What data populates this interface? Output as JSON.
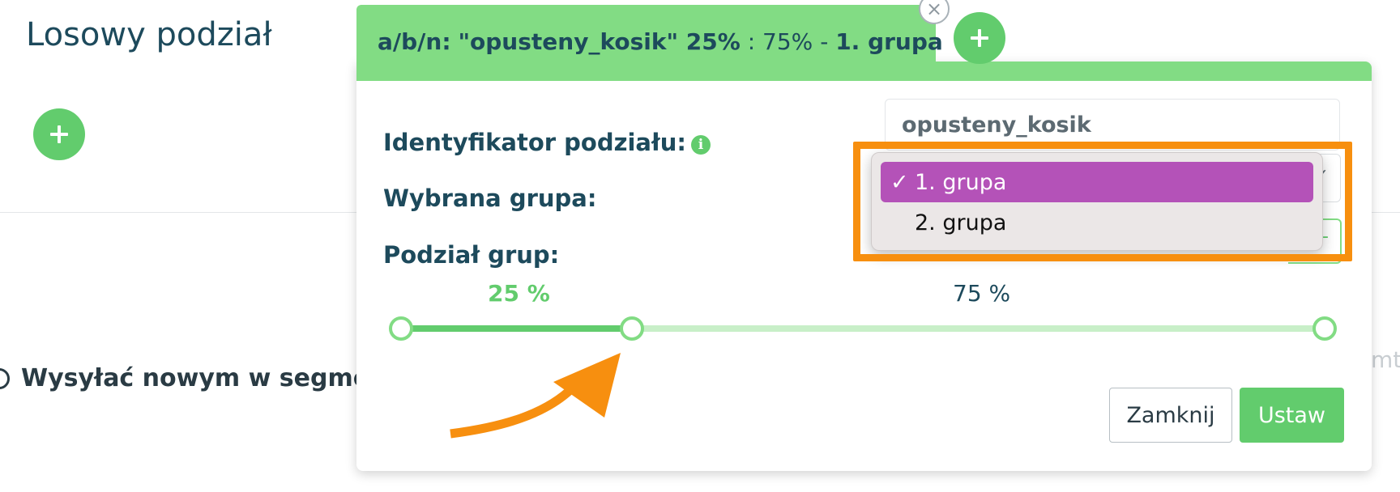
{
  "page": {
    "title": "Losowy podział",
    "segment_option_label": "Wysyłać nowym w segmen",
    "ghost_text": "mt"
  },
  "tab": {
    "prefix": "a/b/n:",
    "name": "\"opusteny_kosik\" 25%",
    "separator": ": 75% -",
    "group": "1. grupa",
    "close_symbol": "×"
  },
  "form": {
    "split_id_label": "Identyfikator podziału:",
    "split_id_value": "opusteny_kosik",
    "info_icon_symbol": "i",
    "selected_group_label": "Wybrana grupa:",
    "group_split_label": "Podział grup:"
  },
  "dropdown": {
    "options": [
      {
        "label": "1. grupa",
        "selected": true
      },
      {
        "label": "2. grupa",
        "selected": false
      }
    ],
    "check_symbol": "✓"
  },
  "slider": {
    "group1_percent_label": "25 %",
    "group2_percent_label": "75 %",
    "split_fraction": 0.25
  },
  "buttons": {
    "close": "Zamknij",
    "set": "Ustaw"
  },
  "colors": {
    "brand_green": "#62cc6d",
    "tab_green": "#82dc84",
    "selection_purple": "#b452b8",
    "annotation_orange": "#f78f0f",
    "text_dark_blue": "#1d4a5c"
  }
}
